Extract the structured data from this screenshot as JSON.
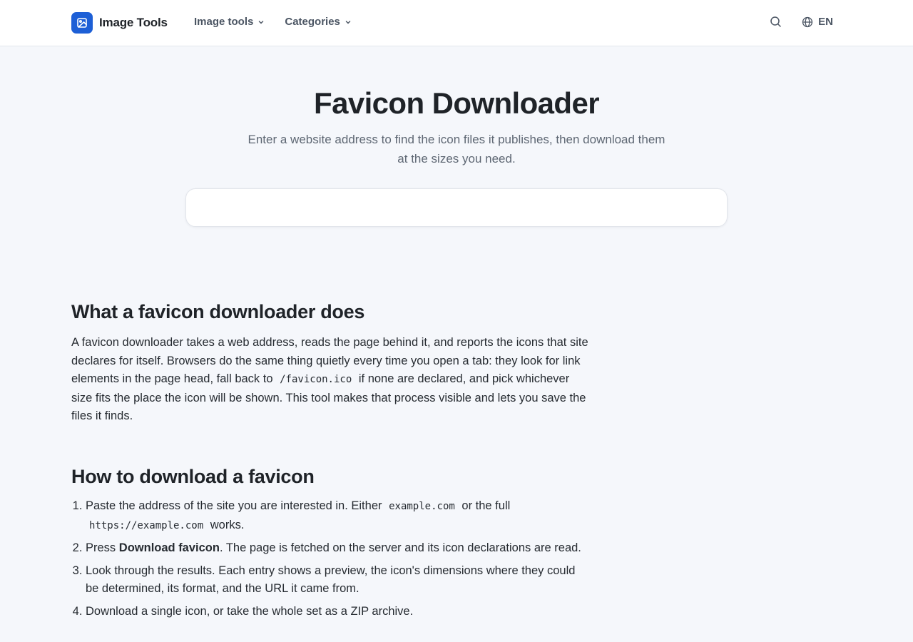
{
  "header": {
    "brand": "Image Tools",
    "nav": [
      {
        "label": "Image tools"
      },
      {
        "label": "Categories"
      }
    ],
    "lang": "EN",
    "icons": {
      "logo": "image-icon",
      "search": "search-icon",
      "lang": "globe-icon",
      "dropdown": "chevron-down-icon"
    }
  },
  "hero": {
    "title": "Favicon Downloader",
    "subtitle": "Enter a website address to find the icon files it publishes, then download them at the sizes you need.",
    "input_value": ""
  },
  "section1": {
    "heading": "What a favicon downloader does",
    "text_a": "A favicon downloader takes a web address, reads the page behind it, and reports the icons that site declares for itself. Browsers do the same thing quietly every time you open a tab: they look for link elements in the page head, fall back to",
    "code": "/favicon.ico",
    "text_b": "if none are declared, and pick whichever size fits the place the icon will be shown. This tool makes that process visible and lets you save the files it finds."
  },
  "section2": {
    "heading": "How to download a favicon",
    "step1_a": "Paste the address of the site you are interested in. Either",
    "step1_code1": "example.com",
    "step1_b": "or the full",
    "step1_code2": "https://example.com",
    "step1_c": "works.",
    "step2_a": "Press",
    "step2_bold": "Download favicon",
    "step2_b": ". The page is fetched on the server and its icon declarations are read.",
    "step3": "Look through the results. Each entry shows a preview, the icon's dimensions where they could be determined, its format, and the URL it came from.",
    "step4": "Download a single icon, or take the whole set as a ZIP archive."
  },
  "colors": {
    "accent": "#1d5fd6",
    "background": "#f5f7fb"
  }
}
